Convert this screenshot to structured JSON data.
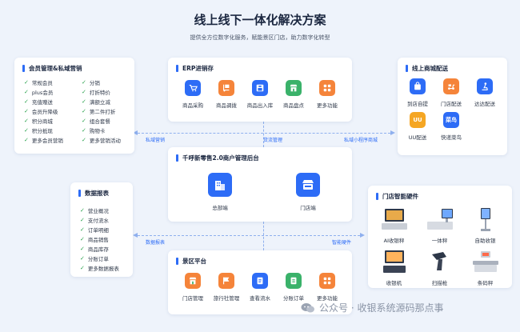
{
  "header": {
    "title": "线上线下一体化解决方案",
    "subtitle": "提供全方位数字化服务，赋能景区门店，助力数字化转型"
  },
  "membership": {
    "title": "会员管理&私域营销",
    "items": [
      "常规会员",
      "分销",
      "plus会员",
      "打折特价",
      "充值赠送",
      "满额立减",
      "会员升降级",
      "第二件打折",
      "积分商城",
      "组合套餐",
      "积分抵现",
      "购物卡",
      "更多会员营销",
      "更多营销活动"
    ]
  },
  "reports": {
    "title": "数据报表",
    "items": [
      "营业概况",
      "支付流水",
      "订单明细",
      "商品销售",
      "商品库存",
      "分账订单",
      "更多数据报表"
    ]
  },
  "erp": {
    "title": "ERP进销存",
    "items": [
      {
        "label": "商品采购",
        "icon": "cart-icon",
        "color": "#2d6cf6"
      },
      {
        "label": "商品调拨",
        "icon": "dolly-icon",
        "color": "#f5843a"
      },
      {
        "label": "商品出入库",
        "icon": "warehouse-icon",
        "color": "#2d6cf6"
      },
      {
        "label": "商品盘点",
        "icon": "store-icon",
        "color": "#3ab26a"
      },
      {
        "label": "更多功能",
        "icon": "grid-icon",
        "color": "#f5843a"
      }
    ]
  },
  "platform": {
    "title": "千呼新零售2.0商户管理后台",
    "items": [
      {
        "label": "总部端",
        "icon": "building-icon"
      },
      {
        "label": "门店端",
        "icon": "shop-icon"
      }
    ]
  },
  "scenic": {
    "title": "景区平台",
    "items": [
      {
        "label": "门店管理",
        "icon": "store-icon",
        "color": "#f5843a"
      },
      {
        "label": "旅行社管理",
        "icon": "flag-icon",
        "color": "#f5843a"
      },
      {
        "label": "查看流水",
        "icon": "doc-icon",
        "color": "#2d6cf6"
      },
      {
        "label": "分账订单",
        "icon": "list-icon",
        "color": "#3ab26a"
      },
      {
        "label": "更多功能",
        "icon": "grid-icon",
        "color": "#f5843a"
      }
    ]
  },
  "online": {
    "title": "线上商城配送",
    "items": [
      {
        "label": "到店自提",
        "icon": "bag-icon",
        "color": "#2d6cf6"
      },
      {
        "label": "门店配送",
        "icon": "scooter-icon",
        "color": "#f5843a"
      },
      {
        "label": "达达配送",
        "icon": "rider-icon",
        "color": "#2d6cf6"
      },
      {
        "label": "UU配送",
        "icon": "uu-icon",
        "color": "#f5a623",
        "text": "UU"
      },
      {
        "label": "快递菜鸟",
        "icon": "cainiao-icon",
        "color": "#2d6cf6",
        "text": "菜鸟"
      }
    ]
  },
  "hardware": {
    "title": "门店智能硬件",
    "items": [
      {
        "label": "AI收银秤",
        "icon": "ai-scale-icon"
      },
      {
        "label": "一体秤",
        "icon": "integrated-scale-icon"
      },
      {
        "label": "自助收银",
        "icon": "kiosk-icon"
      },
      {
        "label": "收银机",
        "icon": "pos-icon"
      },
      {
        "label": "扫描枪",
        "icon": "scanner-icon"
      },
      {
        "label": "条码秤",
        "icon": "barcode-scale-icon"
      }
    ]
  },
  "connectors": {
    "private_marketing": "私域营销",
    "inventory": "货流管理",
    "mini_program": "私域小程序商城",
    "data_report": "数据报表",
    "smart_hardware": "智能硬件"
  },
  "watermark": {
    "text": "公众号 · 收银系统源码那点事"
  }
}
